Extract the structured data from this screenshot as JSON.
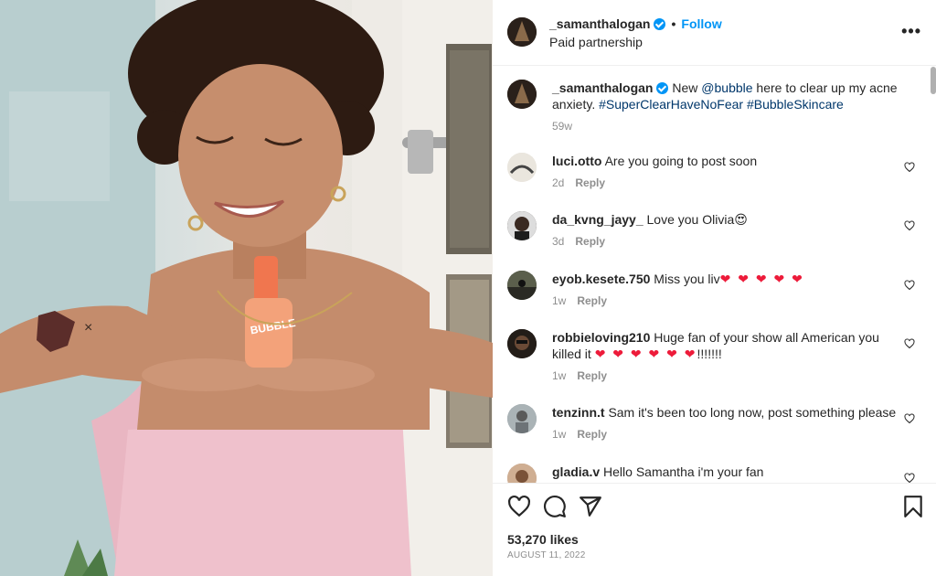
{
  "post": {
    "author": "_samanthalogan",
    "follow_label": "Follow",
    "dot": "•",
    "subtitle": "Paid partnership",
    "more_label": "•••",
    "product_text": "BUBBLE"
  },
  "caption": {
    "username": "_samanthalogan",
    "text_before": "New ",
    "mention": "@bubble",
    "text_after": " here to clear up my acne anxiety. ",
    "hashtags": "#SuperClearHaveNoFear #BubbleSkincare",
    "time": "59w"
  },
  "comments": [
    {
      "username": "luci.otto",
      "text": "Are you going to post soon",
      "time": "2d",
      "reply": "Reply"
    },
    {
      "username": "da_kvng_jayy_",
      "text": "Love you Olivia",
      "emoji": "😍",
      "time": "3d",
      "reply": "Reply"
    },
    {
      "username": "eyob.kesete.750",
      "text": "Miss you liv",
      "emoji": "❤ ❤ ❤ ❤ ❤",
      "time": "1w",
      "reply": "Reply"
    },
    {
      "username": "robbieloving210",
      "text": "Huge fan of your show all American you killed it",
      "emoji": "❤ ❤ ❤ ❤ ❤ ❤",
      "text_tail": "!!!!!!!",
      "time": "1w",
      "reply": "Reply"
    },
    {
      "username": "tenzinn.t",
      "text": "Sam it's been too long now, post something please",
      "time": "1w",
      "reply": "Reply"
    },
    {
      "username": "gladia.v",
      "text": "Hello Samantha i'm your fan",
      "time": "",
      "reply": ""
    }
  ],
  "likes": "53,270 likes",
  "date": "AUGUST 11, 2022",
  "colors": {
    "accent": "#0095f6",
    "link": "#00376b",
    "heart": "#ed1b3a",
    "muted": "#8e8e8e"
  },
  "icons": [
    "verified-badge-icon",
    "more-icon",
    "heart-icon",
    "comment-icon",
    "share-icon",
    "save-icon"
  ]
}
